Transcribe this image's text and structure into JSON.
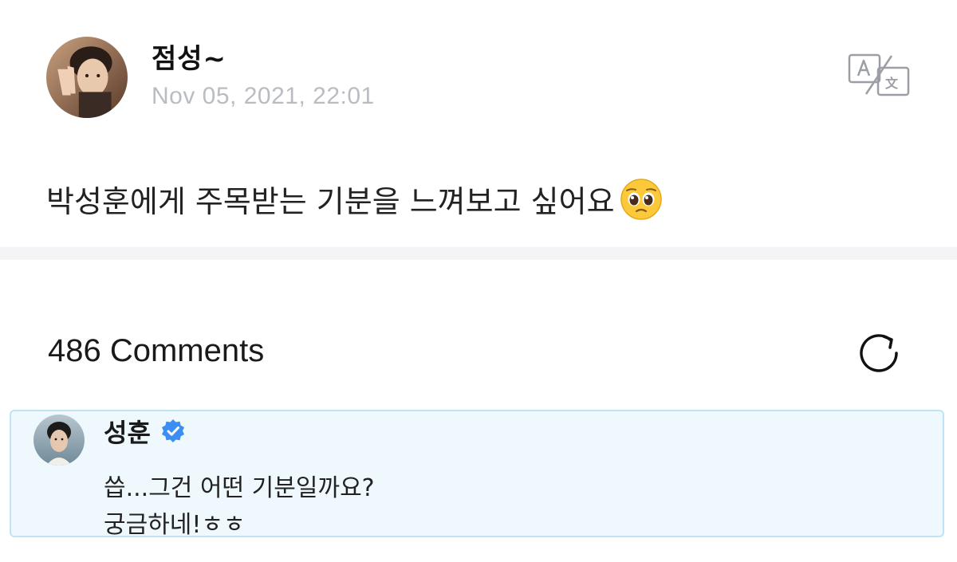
{
  "post": {
    "author": "점성~",
    "timestamp": "Nov 05, 2021, 22:01",
    "body": "박성훈에게 주목받는 기분을 느껴보고 싶어요",
    "body_emoji": "pleading-face-emoji",
    "translate_icon": "translate-icon"
  },
  "comments": {
    "count_label": "486 Comments",
    "refresh_icon": "refresh-icon"
  },
  "highlighted_comment": {
    "author": "성훈",
    "verified": true,
    "lines": [
      "씁...그건 어떤 기분일까요?",
      "궁금하네!ㅎㅎ"
    ]
  },
  "colors": {
    "timestamp": "#b9bcc2",
    "divider": "#f4f4f7",
    "comment_bg": "#eef8fd",
    "comment_border": "#bfe4f5",
    "verified_badge": "#3b8ff3"
  }
}
